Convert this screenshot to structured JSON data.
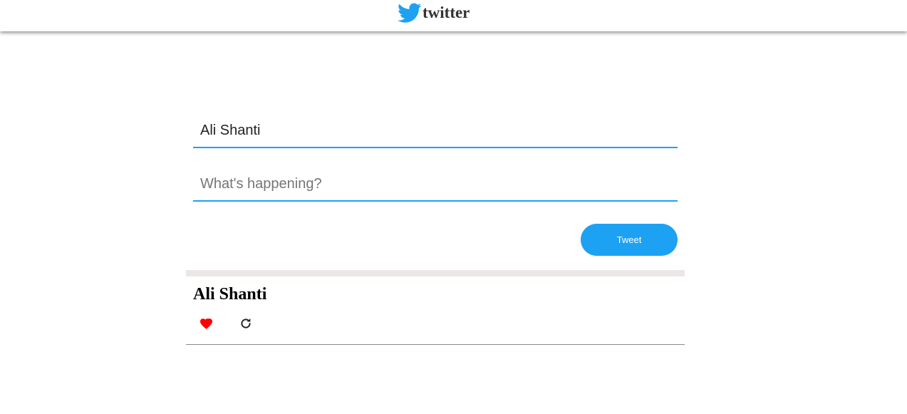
{
  "header": {
    "brand_text": "twitter",
    "brand_icon": "twitter-bird-icon",
    "brand_color": "#1da1f2"
  },
  "composer": {
    "name_value": "Ali Shanti",
    "message_placeholder": "What's happening?",
    "tweet_button_label": "Tweet",
    "accent_color": "#1da1f2"
  },
  "tweets": [
    {
      "author": "Ali Shanti",
      "like_icon": "heart-icon",
      "like_color": "#ff0000",
      "retweet_icon": "refresh-icon"
    }
  ]
}
